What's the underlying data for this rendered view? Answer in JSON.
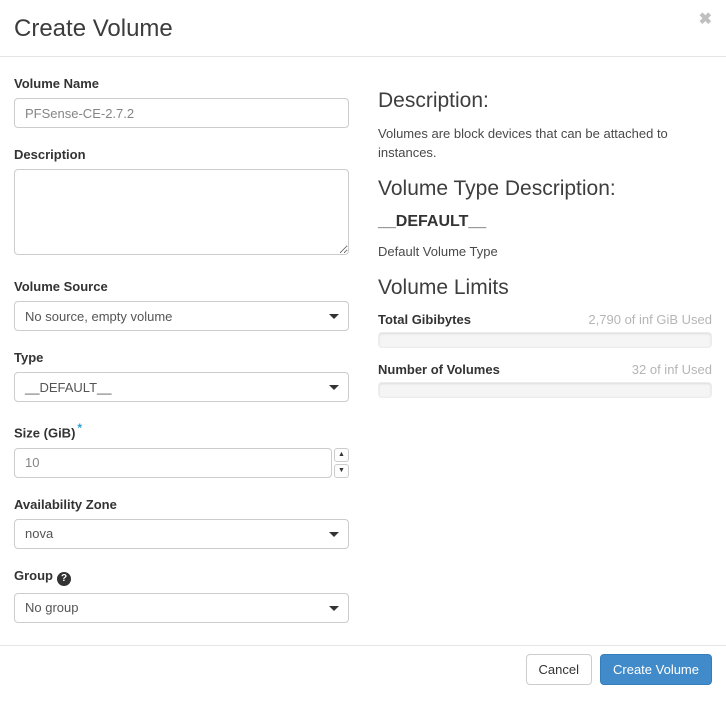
{
  "modal": {
    "title": "Create Volume",
    "close_icon": "✖"
  },
  "form": {
    "volume_name": {
      "label": "Volume Name",
      "value": "PFSense-CE-2.7.2"
    },
    "description": {
      "label": "Description",
      "value": ""
    },
    "volume_source": {
      "label": "Volume Source",
      "selected": "No source, empty volume"
    },
    "type": {
      "label": "Type",
      "selected": "__DEFAULT__"
    },
    "size": {
      "label": "Size (GiB)",
      "required_mark": "*",
      "value": "10",
      "spinner_up": "▲",
      "spinner_down": "▼"
    },
    "availability_zone": {
      "label": "Availability Zone",
      "selected": "nova"
    },
    "group": {
      "label": "Group",
      "help_icon": "?",
      "selected": "No group"
    }
  },
  "info": {
    "description_heading": "Description:",
    "description_text": "Volumes are block devices that can be attached to instances.",
    "type_description_heading": "Volume Type Description:",
    "type_name": "__DEFAULT__",
    "type_description": "Default Volume Type",
    "limits_heading": "Volume Limits",
    "limits": [
      {
        "label": "Total Gibibytes",
        "usage": "2,790 of inf GiB Used",
        "percent": 0
      },
      {
        "label": "Number of Volumes",
        "usage": "32 of inf Used",
        "percent": 0
      }
    ]
  },
  "footer": {
    "cancel_label": "Cancel",
    "submit_label": "Create Volume"
  },
  "colors": {
    "primary_button": "#428bca",
    "required_asterisk": "#2d9fd8",
    "divider": "#e5e5e5",
    "muted_text": "#b5b5b5"
  }
}
